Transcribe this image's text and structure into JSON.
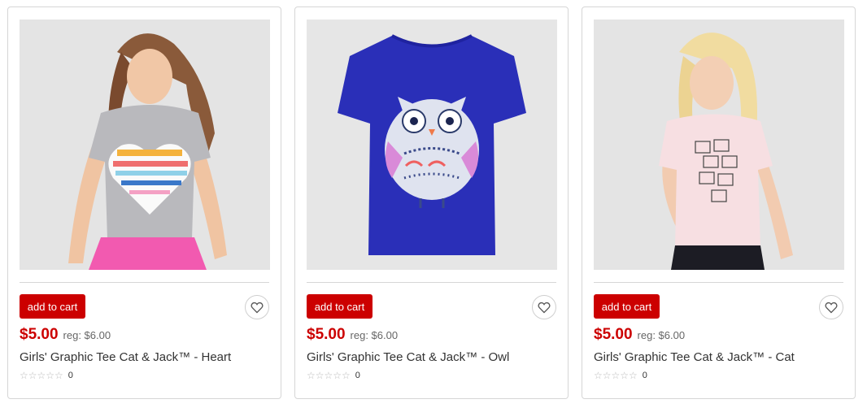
{
  "products": [
    {
      "add_to_cart_label": "add to cart",
      "price": "$5.00",
      "regular_price": "reg: $6.00",
      "title": "Girls' Graphic Tee Cat & Jack™ - Heart",
      "stars": "☆☆☆☆☆",
      "review_count": "0"
    },
    {
      "add_to_cart_label": "add to cart",
      "price": "$5.00",
      "regular_price": "reg: $6.00",
      "title": "Girls' Graphic Tee Cat & Jack™ - Owl",
      "stars": "☆☆☆☆☆",
      "review_count": "0"
    },
    {
      "add_to_cart_label": "add to cart",
      "price": "$5.00",
      "regular_price": "reg: $6.00",
      "title": "Girls' Graphic Tee Cat & Jack™ - Cat",
      "stars": "☆☆☆☆☆",
      "review_count": "0"
    }
  ],
  "colors": {
    "accent": "#cc0000",
    "border": "#d6d6d6",
    "image_bg": "#e6e6e6"
  },
  "icons": {
    "favorite": "heart-outline-icon",
    "rating": "star-outline-icon"
  }
}
